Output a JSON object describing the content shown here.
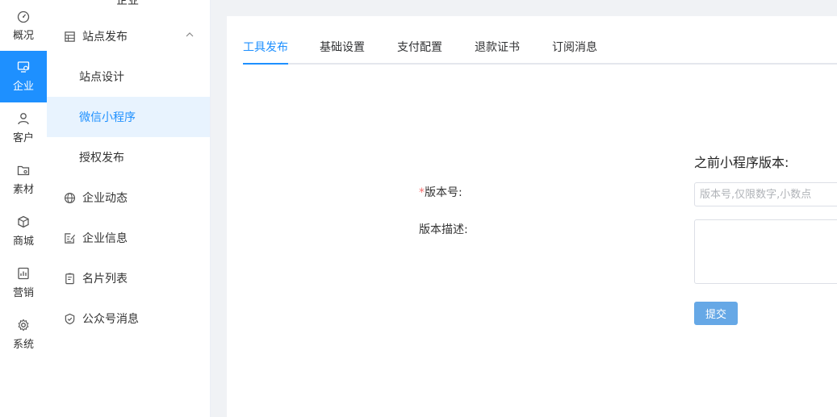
{
  "rail": {
    "items": [
      {
        "label": "概况",
        "icon": "dashboard-icon"
      },
      {
        "label": "企业",
        "icon": "monitor-settings-icon"
      },
      {
        "label": "客户",
        "icon": "user-icon"
      },
      {
        "label": "素材",
        "icon": "folder-icon"
      },
      {
        "label": "商城",
        "icon": "box-icon"
      },
      {
        "label": "营销",
        "icon": "chart-icon"
      },
      {
        "label": "系统",
        "icon": "gear-icon"
      }
    ],
    "active_index": 1,
    "accent": "#1e90ff"
  },
  "sidebar": {
    "top_partial": "企业",
    "items": [
      {
        "label": "站点发布",
        "icon": "table-icon"
      },
      {
        "label": "站点设计"
      },
      {
        "label": "微信小程序"
      },
      {
        "label": "授权发布"
      },
      {
        "label": "企业动态",
        "icon": "globe-icon"
      },
      {
        "label": "企业信息",
        "icon": "edit-document-icon"
      },
      {
        "label": "名片列表",
        "icon": "card-list-icon"
      },
      {
        "label": "公众号消息",
        "icon": "check-shield-icon"
      }
    ],
    "active_label": "微信小程序"
  },
  "tabs": [
    {
      "label": "工具发布",
      "active": true
    },
    {
      "label": "基础设置"
    },
    {
      "label": "支付配置"
    },
    {
      "label": "退款证书"
    },
    {
      "label": "订阅消息"
    }
  ],
  "form": {
    "previous_version_label": "之前小程序版本:",
    "version_label": "版本号:",
    "version_required_mark": "*",
    "version_placeholder": "版本号,仅限数字,小数点",
    "version_value": "",
    "description_label": "版本描述:",
    "description_value": "",
    "submit_label": "提交"
  }
}
